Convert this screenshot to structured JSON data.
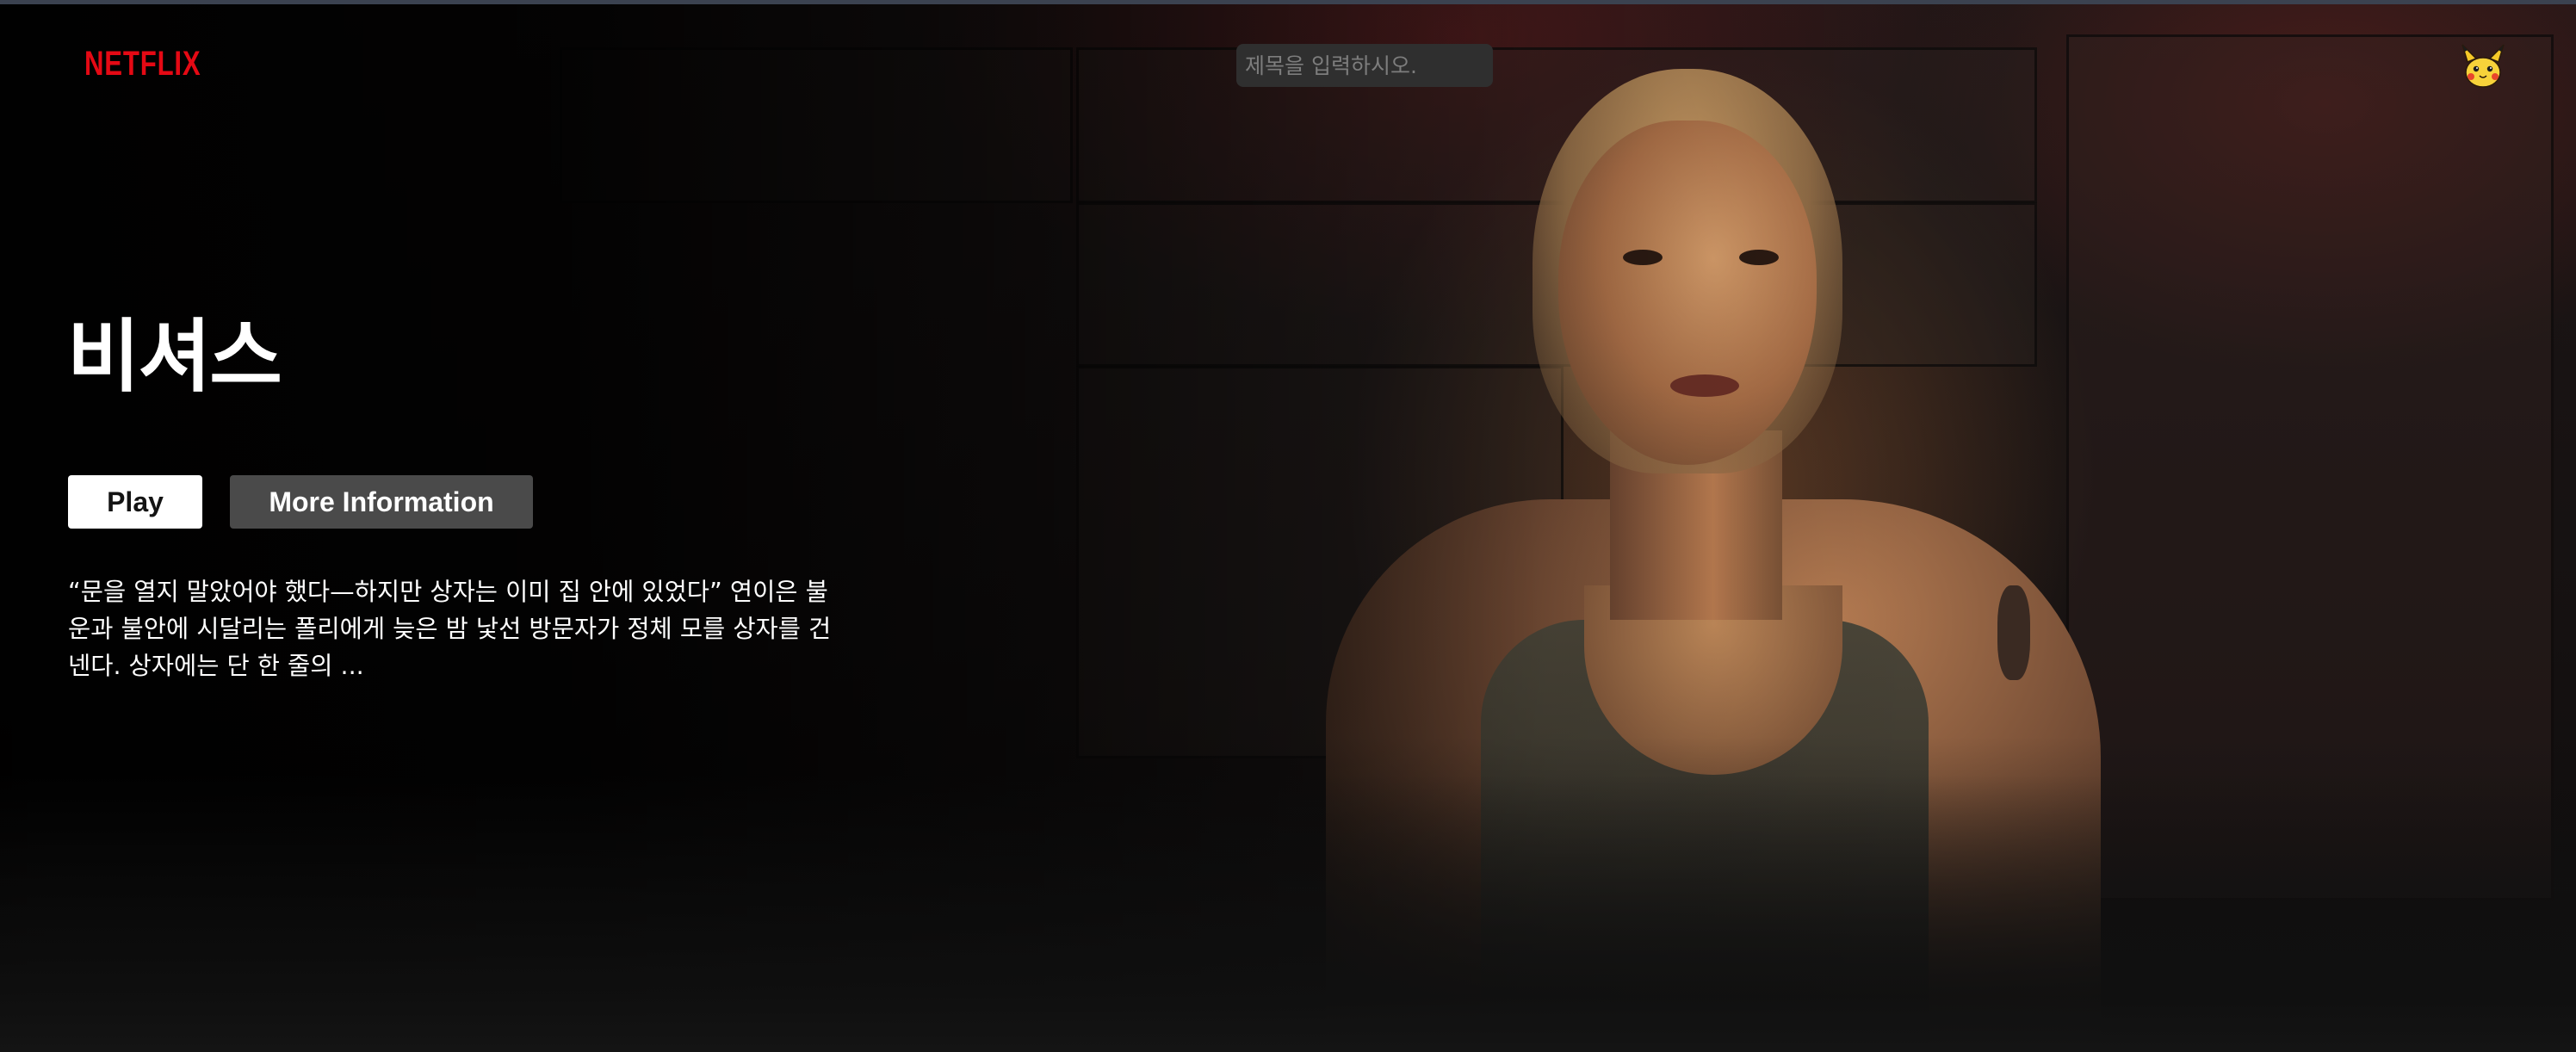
{
  "header": {
    "logo_text": "NETFLIX",
    "search": {
      "placeholder": "제목을 입력하시오.",
      "value": ""
    },
    "avatar_icon": "pikachu-avatar-icon"
  },
  "hero": {
    "title": "비셔스",
    "buttons": {
      "play_label": "Play",
      "more_info_label": "More Information"
    },
    "description": "“문을 열지 말았어야 했다—하지만 상자는 이미 집 안에 있었다” 연이은 불운과 불안에 시달리는 폴리에게 늦은 밤 낯선 방문자가 정체 모를 상자를 건넨다. 상자에는 단 한 줄의 ..."
  },
  "colors": {
    "brand": "#e50914",
    "play_bg": "#ffffff",
    "info_bg": "#4a4a4a",
    "search_bg": "#2f2f2f"
  }
}
